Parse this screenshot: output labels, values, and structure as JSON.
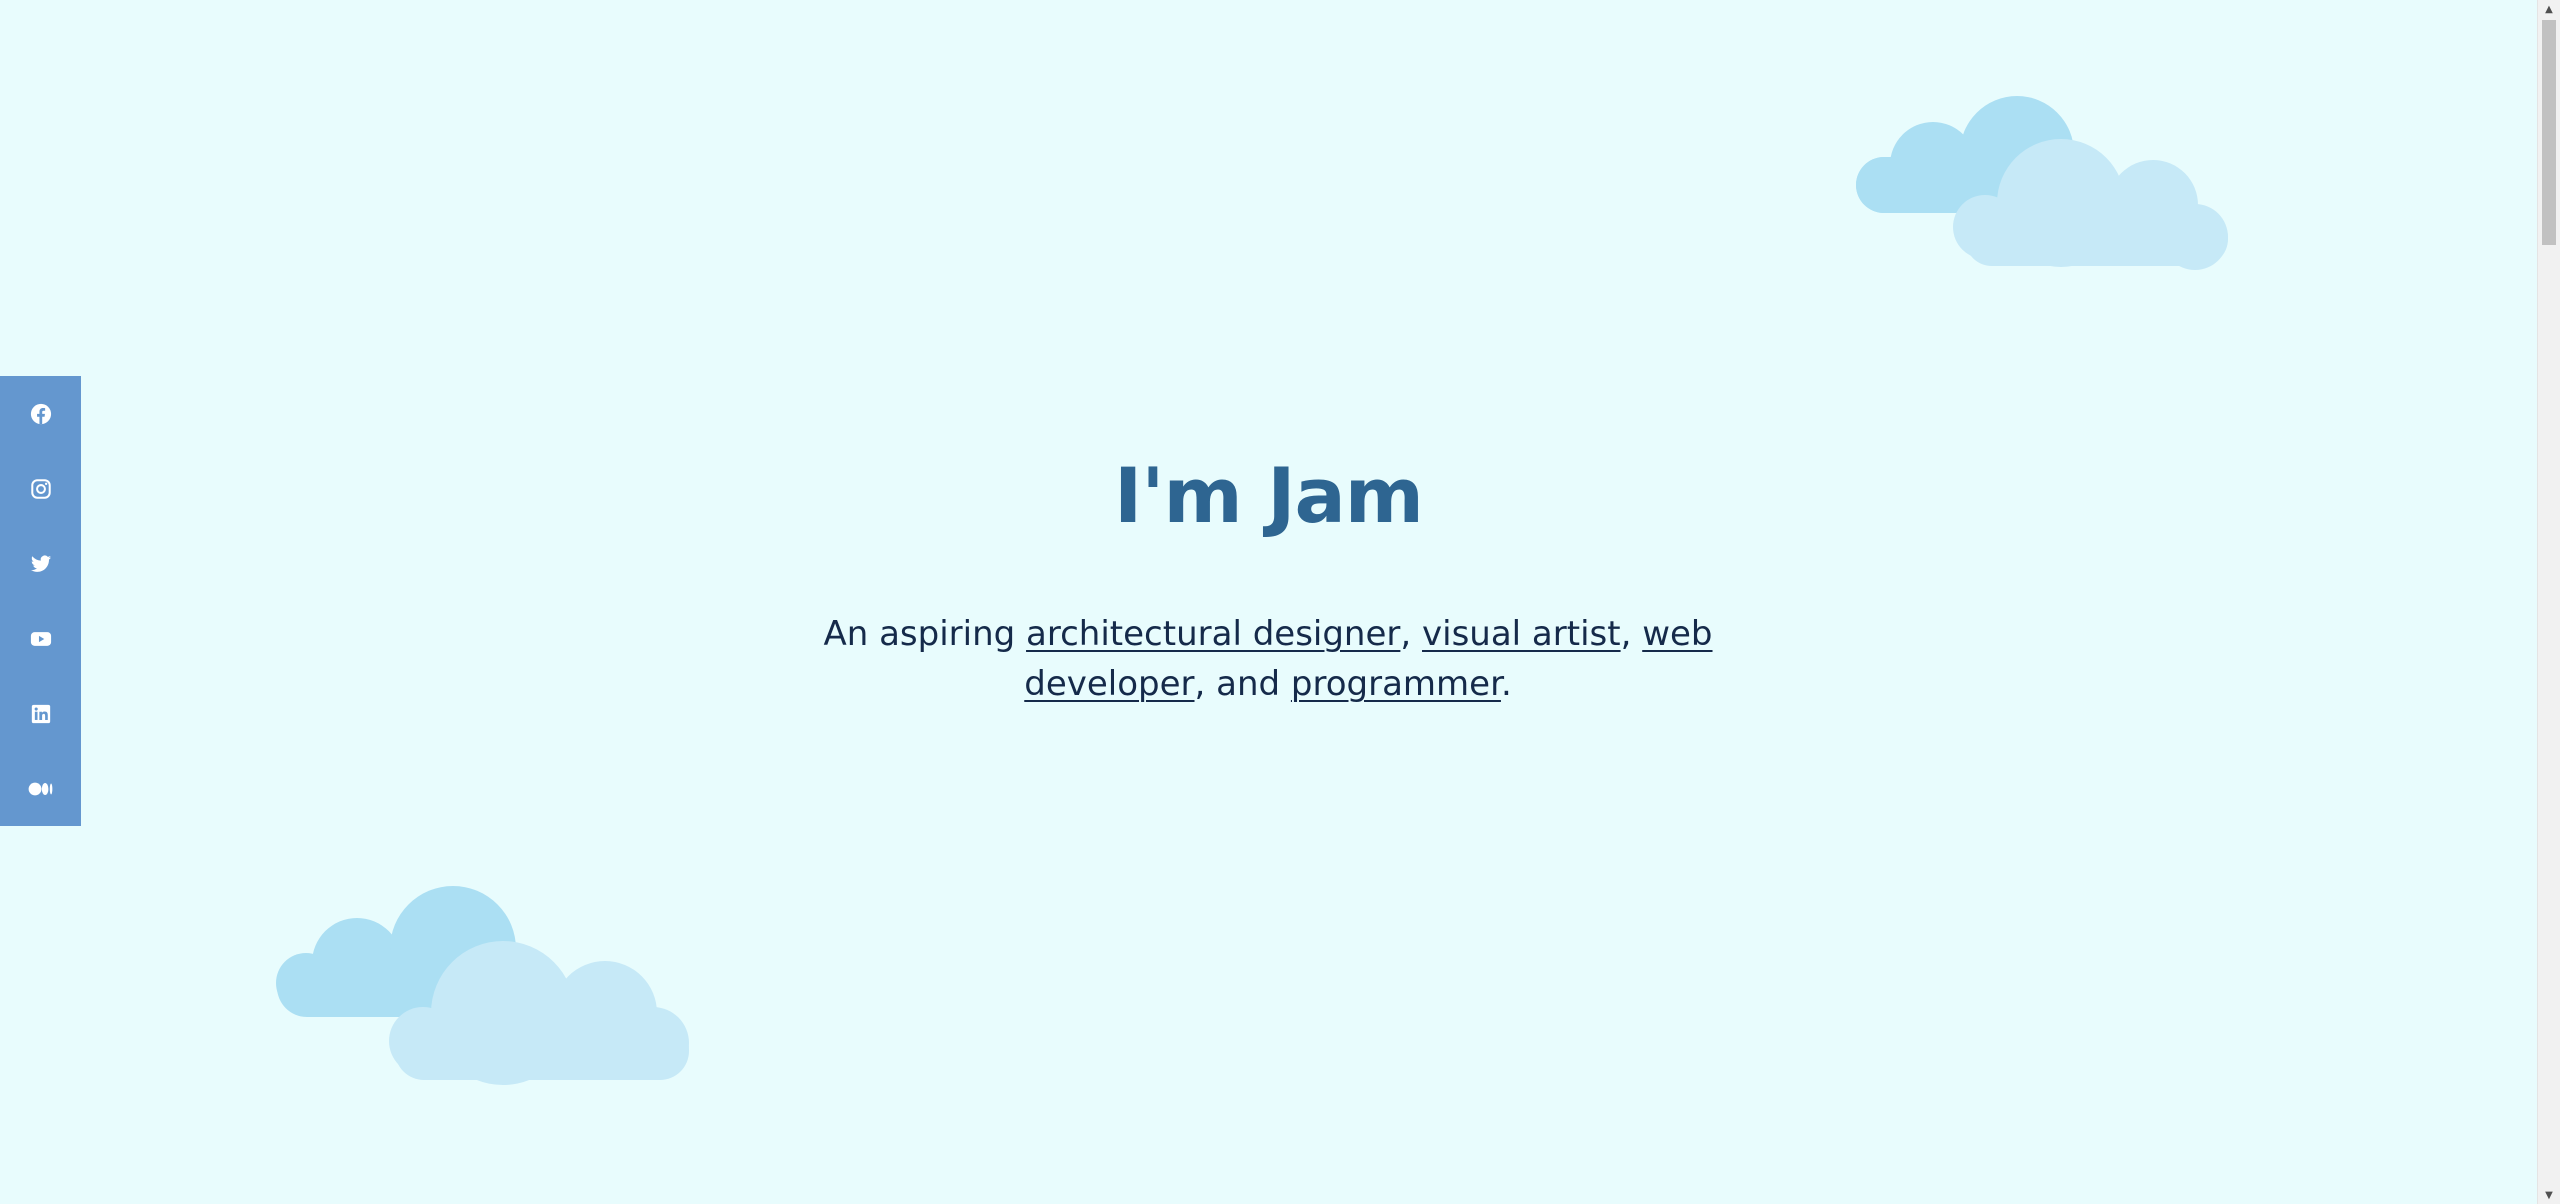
{
  "hero": {
    "title": "I'm Jam",
    "subtitle_prefix": "An aspiring ",
    "links": [
      {
        "label": "architectural designer"
      },
      {
        "label": "visual artist"
      },
      {
        "label": "web developer"
      },
      {
        "label": "programmer"
      }
    ],
    "sep1": ", ",
    "sep2": ", ",
    "sep3": ", and ",
    "suffix": "."
  },
  "social": {
    "items": [
      {
        "icon": "facebook-icon"
      },
      {
        "icon": "instagram-icon"
      },
      {
        "icon": "twitter-icon"
      },
      {
        "icon": "youtube-icon"
      },
      {
        "icon": "linkedin-icon"
      },
      {
        "icon": "medium-icon"
      }
    ]
  },
  "colors": {
    "background": "#e8fcfd",
    "sidebar": "#6497cf",
    "title": "#2e6591",
    "text": "#152a4a",
    "cloud_back": "#abdff3",
    "cloud_front": "#c6e9f7"
  }
}
